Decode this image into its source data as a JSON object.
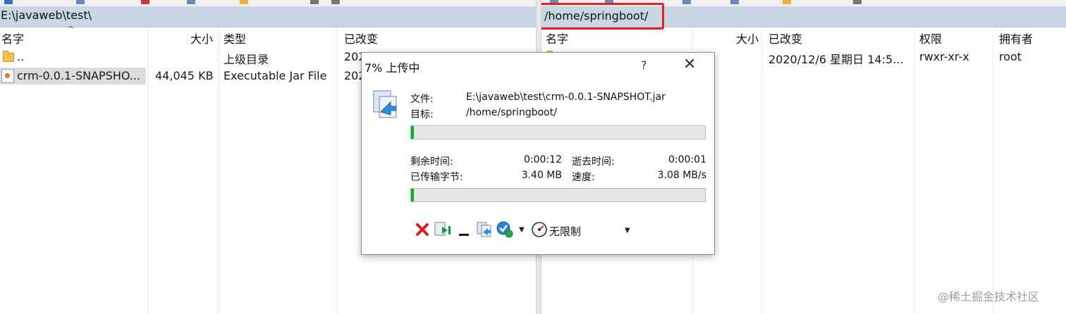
{
  "left_pane": {
    "path": "E:\\javaweb\\test\\",
    "columns": {
      "name": "名字",
      "size": "大小",
      "type": "类型",
      "modified": "已改变"
    },
    "rows": [
      {
        "name": "..",
        "size": "",
        "type": "上级目录",
        "modified": "202"
      },
      {
        "name": "crm-0.0.1-SNAPSHO...",
        "size": "44,045 KB",
        "type": "Executable Jar File",
        "modified": "202"
      }
    ]
  },
  "right_pane": {
    "path": "/home/springboot/",
    "columns": {
      "name": "名字",
      "size": "大小",
      "modified": "已改变",
      "permissions": "权限",
      "owner": "拥有者"
    },
    "rows": [
      {
        "name": "",
        "size": "",
        "modified": "2020/12/6 星期日 14:5...",
        "permissions": "rwxr-xr-x",
        "owner": "root"
      }
    ]
  },
  "dialog": {
    "title": "7% 上传中",
    "help": "?",
    "close": "✕",
    "file_label": "文件:",
    "file_value": "E:\\javaweb\\test\\crm-0.0.1-SNAPSHOT.jar",
    "target_label": "目标:",
    "target_value": "/home/springboot/",
    "file_progress": 0.01,
    "remaining_label": "剩余时间:",
    "remaining_value": "0:00:12",
    "elapsed_label": "逝去时间:",
    "elapsed_value": "0:00:01",
    "transferred_label": "已传输字节:",
    "transferred_value": "3.40 MB",
    "speed_label": "速度:",
    "speed_value": "3.08 MB/s",
    "total_progress": 0.01,
    "speed_limit": "无限制",
    "tools": [
      "cancel-icon",
      "transfer-queue-icon",
      "minimize-icon",
      "background-icon",
      "done-action-icon",
      "speed-limit-icon"
    ]
  },
  "watermark": "@稀土掘金技术社区",
  "colors": {
    "highlight": "#e52222",
    "progress": "#06b025",
    "pathbar": "#c9d6e3"
  }
}
